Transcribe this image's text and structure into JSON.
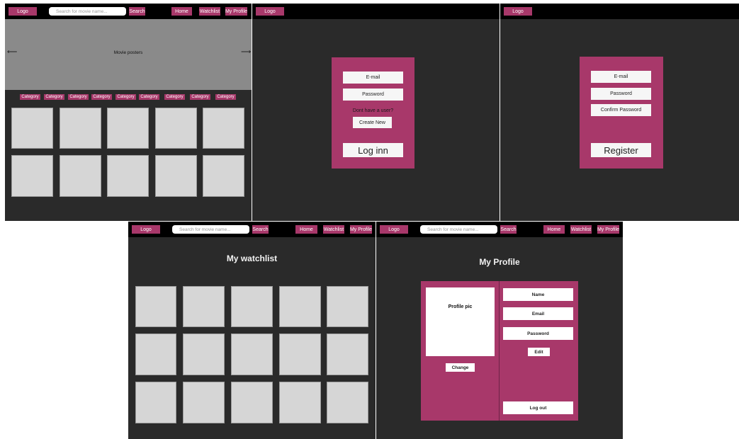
{
  "nav": {
    "logo": "Logo",
    "search_placeholder": "Search for movie name...",
    "search_button": "Search",
    "home": "Home",
    "watchlist": "Watchlist",
    "profile": "My Profile"
  },
  "home": {
    "carousel_label": "Movie posters",
    "arrow_left": "⟵",
    "arrow_right": "⟶",
    "categories": [
      "Category",
      "Category",
      "Category",
      "Category",
      "Category",
      "Category",
      "Category",
      "Category",
      "Category"
    ]
  },
  "login": {
    "email": "E-mail",
    "password": "Password",
    "no_user_text": "Dont have a user?",
    "create_new": "Create New",
    "login_button": "Log inn"
  },
  "register": {
    "email": "E-mail",
    "password": "Password",
    "confirm_password": "Confirm Password",
    "register_button": "Register"
  },
  "watchlist_page": {
    "title": "My watchlist"
  },
  "profile_page": {
    "title": "My Profile",
    "profile_pic": "Profile pic",
    "change": "Change",
    "name": "Name",
    "email": "Email",
    "password": "Password",
    "edit": "Edit",
    "logout": "Log out"
  },
  "colors": {
    "accent": "#a8386a",
    "panel_bg": "#2a2a2a",
    "topbar": "#000000",
    "tile": "#d6d6d6",
    "hero": "#8a8a8a"
  }
}
